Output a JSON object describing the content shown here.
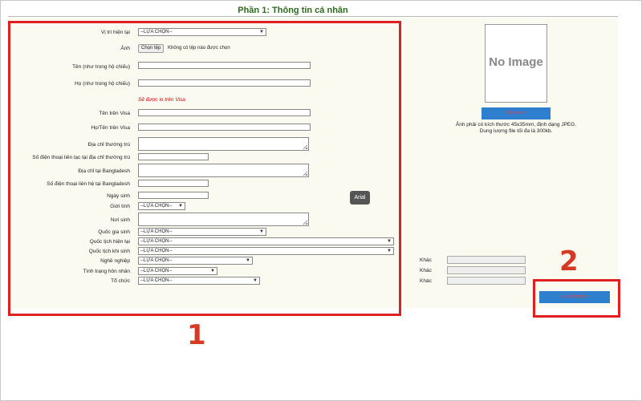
{
  "header": {
    "title": "Phần 1: Thông tin cá nhân"
  },
  "form": {
    "position_label": "Vị trí hiện tại",
    "position_value": "--LỰA CHỌN--",
    "photo_label": "Ảnh",
    "file_button": "Chọn tệp",
    "file_status": "Không có tệp nào được chọn",
    "first_name_label": "Tên (như trong hộ chiếu)",
    "last_name_label": "Họ (như trong hộ chiếu)",
    "visa_note": "Sẽ được in trên Visa",
    "visa_first_label": "Tên trên Visa",
    "visa_full_label": "Họ/Tên trên Visa",
    "perm_address_label": "Địa chỉ thường trú",
    "perm_phone_label": "Số điện thoại liên lạc tại địa chỉ thường trú",
    "bd_address_label": "Địa chỉ tại Bangladesh",
    "bd_phone_label": "Số điện thoại liên hệ tại Bangladesh",
    "dob_label": "Ngày sinh",
    "gender_label": "Giới tính",
    "gender_value": "--LỰA CHỌN--",
    "birthplace_label": "Nơi sinh",
    "birth_country_label": "Quốc gia sinh",
    "birth_country_value": "--LỰA CHỌN--",
    "current_nat_label": "Quốc tịch hiện tại",
    "current_nat_value": "--LỰA CHỌN--",
    "birth_nat_label": "Quốc tịch khi sinh",
    "birth_nat_value": "--LỰA CHỌN--",
    "occupation_label": "Nghề nghiệp",
    "occupation_value": "--LỰA CHỌN--",
    "marital_label": "Tình trạng hôn nhân",
    "marital_value": "--LỰA CHỌN--",
    "org_label": "Tổ chức",
    "org_value": "--LỰA CHỌN--",
    "other_label": "Khác",
    "font_tooltip": "Arial"
  },
  "photo_panel": {
    "placeholder": "No Image",
    "upload_button": "Tải ảnh lên",
    "note_line1": "Ảnh phải có kích thước 45x35mm, định dạng JPEG.",
    "note_line2": "Dung lượng file tối đa là 300kb."
  },
  "actions": {
    "save_button": "Lưu & Tiếp theo"
  },
  "annotations": {
    "marker1": "1",
    "marker2": "2",
    "highlight_color": "#e02020"
  },
  "icons": {
    "select_chevron": "chevron-down-icon",
    "textarea_resize": "resize-grip-icon"
  }
}
